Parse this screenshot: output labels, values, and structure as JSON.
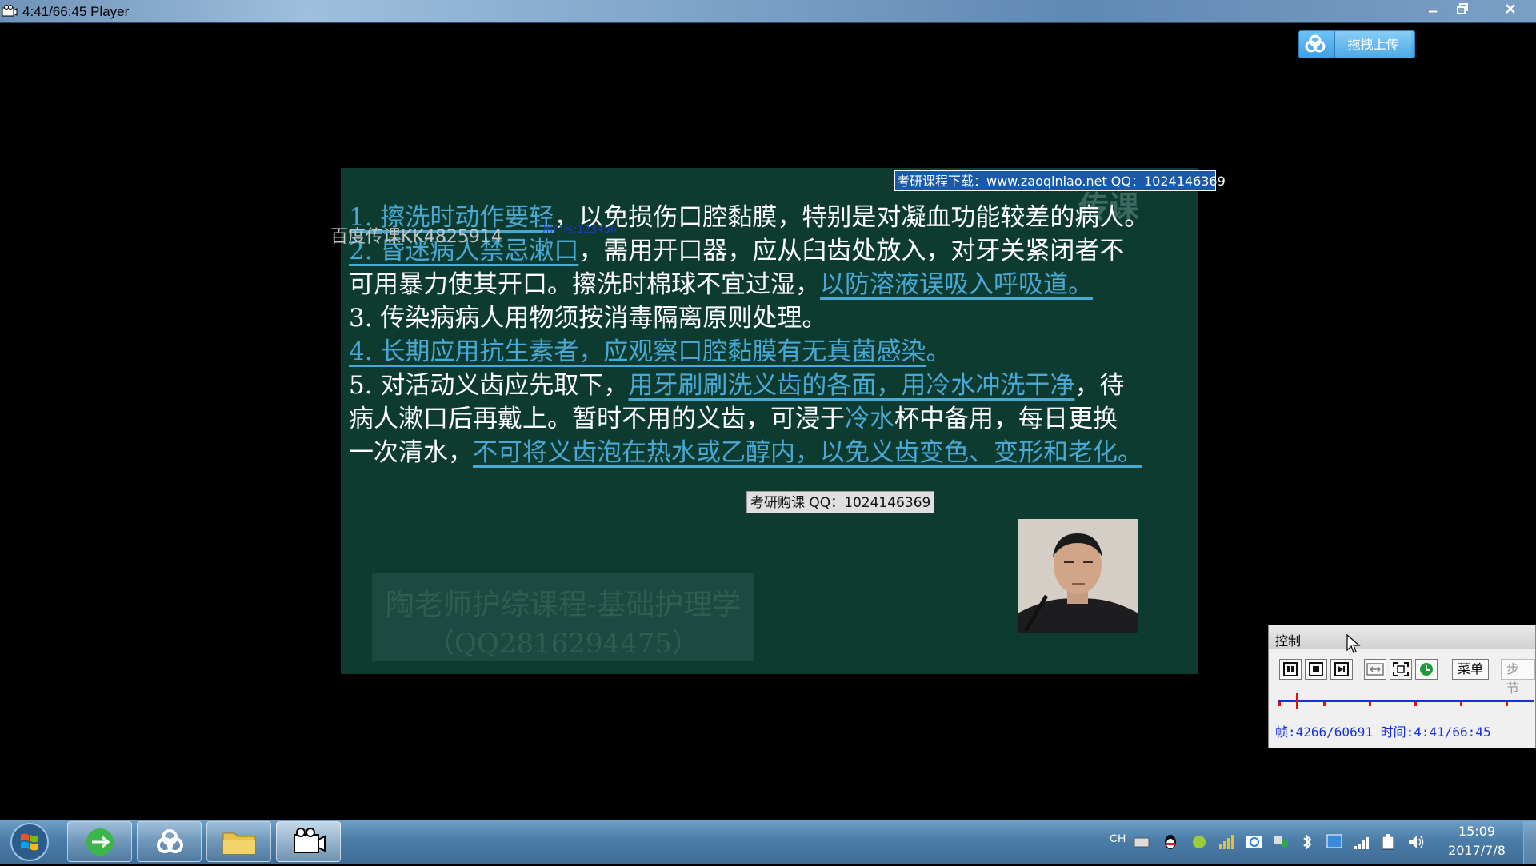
{
  "window": {
    "title": "4:41/66:45 Player"
  },
  "cloud_upload": {
    "label": "拖拽上传"
  },
  "slide": {
    "lines": [
      {
        "hl": "1. 擦洗时动作要轻",
        "rest": "，以免损伤口腔黏膜，特别是对凝血功能较差的病人。"
      },
      {
        "hl": "2. 昏迷病人禁忌漱口",
        "rest": "，需用开口器，应从臼齿处放入，对牙关紧闭者不"
      },
      {
        "plain": "可用暴力使其开口。擦洗时棉球不宜过湿，",
        "hl": "以防溶液误吸入呼吸道。"
      },
      {
        "plain": "3. 传染病病人用物须按消毒隔离原则处理。"
      },
      {
        "hl": "4. 长期应用抗生素者，应观察口腔黏膜有无真菌感染",
        "rest": "。"
      },
      {
        "plain": "5. 对活动义齿应先取下，",
        "hl": "用牙刷刷洗义齿的各面，用冷水冲洗干净",
        "rest": "，待"
      },
      {
        "pre": "病人漱口后再戴上。暂时不用的义齿，可浸于",
        "hl_plain": "冷水",
        "rest": "杯中备用，每日更换"
      },
      {
        "plain": "一次清水，",
        "hl": "不可将义齿泡在热水或乙醇内，以免义齿变色、变形和老化。"
      }
    ],
    "faint_logo": "传课",
    "faint_title": "陶老师护综课程-基础护理学",
    "faint_subtitle": "（QQ2816294475）"
  },
  "overlays": {
    "top_banner": "考研课程下载：www.zaoqiniao.net QQ：1024146369",
    "grey_watermark": "百度传课KK4825914",
    "blue_watermark": "用户名:123456",
    "qq_badge": "考研购课 QQ：1024146369"
  },
  "control_panel": {
    "title": "控制",
    "menu_label": "菜单",
    "step_label": "步节",
    "frame_label": "帧:4266/60691",
    "time_label": "时间:4:41/66:45",
    "progress": 0.07
  },
  "taskbar": {
    "lang": "CH",
    "clock_time": "15:09",
    "clock_date": "2017/7/8"
  },
  "colors": {
    "slide_bg": "#0d3b30",
    "highlight": "#49a9d6",
    "banner_blue": "#1a59a8",
    "status_blue": "#1530e0"
  }
}
